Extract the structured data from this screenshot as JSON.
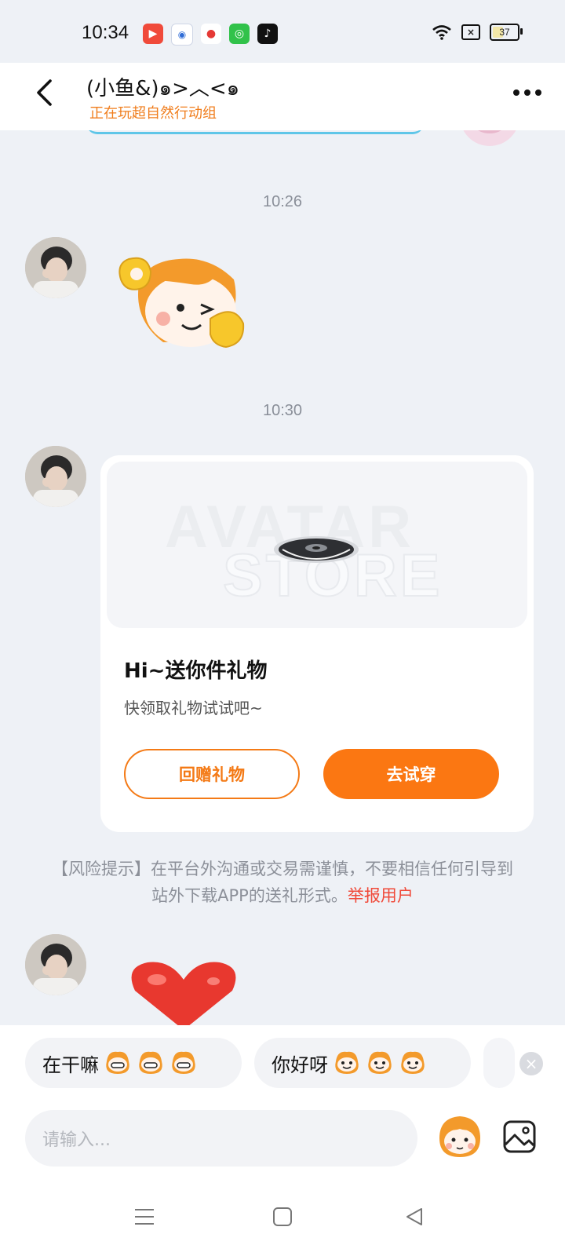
{
  "status_bar": {
    "time": "10:34",
    "battery_level": "37",
    "battery_fraction": 0.37,
    "app_icons": [
      "video-app-icon",
      "baidu-map-icon",
      "location-app-icon",
      "green-app-icon",
      "tiktok-icon"
    ]
  },
  "header": {
    "name": "(小鱼&)๑>︿<๑",
    "subtitle": "正在玩超自然行动组"
  },
  "messages": [
    {
      "time": "10:26",
      "type": "sticker",
      "sticker": "monkey-ok-wink-sticker"
    },
    {
      "time": "10:30",
      "type": "gift_card",
      "banner_watermark_1": "AVATAR",
      "banner_watermark_2": "STORE",
      "title": "Hi~送你件礼物",
      "desc": "快领取礼物试试吧~",
      "return_gift_label": "回赠礼物",
      "try_on_label": "去试穿"
    },
    {
      "type": "sticker",
      "sticker": "red-heart-sticker"
    }
  ],
  "risk_notice": {
    "text": "【风险提示】在平台外沟通或交易需谨慎，不要相信任何引导到站外下载APP的送礼形式。",
    "link": "举报用户"
  },
  "quick_replies": [
    {
      "text": "在干嘛",
      "emoji_icon": "monkey-grin-emoji",
      "emoji_count": 3
    },
    {
      "text": "你好呀",
      "emoji_icon": "monkey-smile-emoji",
      "emoji_count": 3
    }
  ],
  "input": {
    "placeholder": "请输入..."
  },
  "colors": {
    "accent": "#fb7712",
    "link_red": "#f04a3a",
    "subtitle_orange": "#f07d1c"
  }
}
